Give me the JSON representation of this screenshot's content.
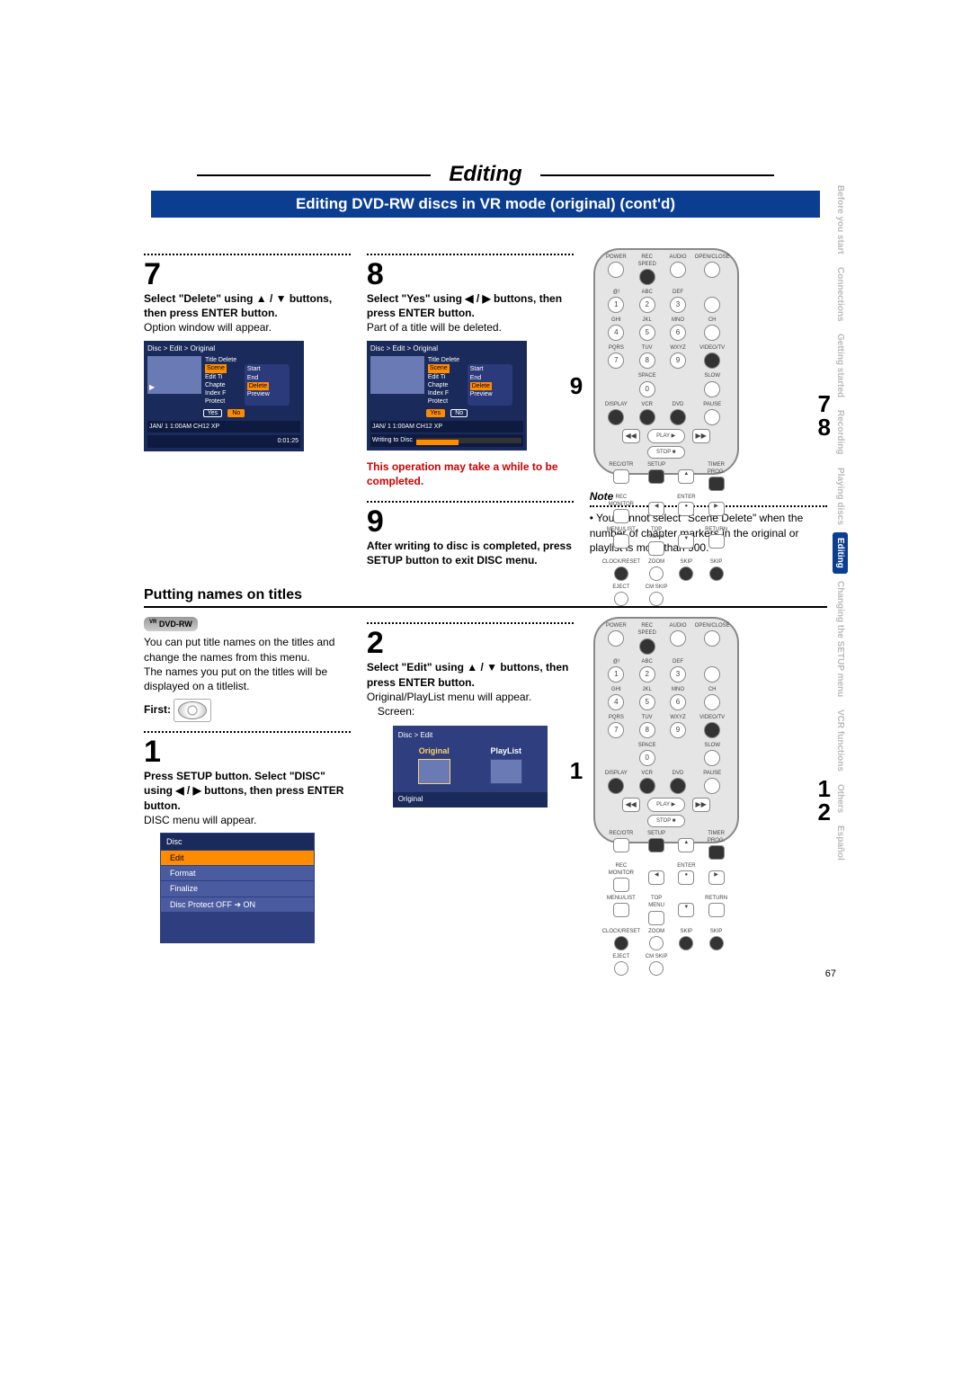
{
  "heading": "Editing",
  "subheading": "Editing DVD-RW discs in VR mode (original) (cont'd)",
  "sidetabs": [
    {
      "label": "Before you start",
      "active": false
    },
    {
      "label": "Connections",
      "active": false
    },
    {
      "label": "Getting started",
      "active": false
    },
    {
      "label": "Recording",
      "active": false
    },
    {
      "label": "Playing discs",
      "active": false
    },
    {
      "label": "Editing",
      "active": true
    },
    {
      "label": "Changing the SETUP menu",
      "active": false
    },
    {
      "label": "VCR functions",
      "active": false
    },
    {
      "label": "Others",
      "active": false
    },
    {
      "label": "Español",
      "active": false
    }
  ],
  "page_number": "67",
  "top": {
    "step7": {
      "num": "7",
      "instr": "Select \"Delete\" using ▲ / ▼ buttons, then press ENTER button.",
      "body": "Option window will appear.",
      "osd": {
        "crumb": "Disc > Edit > Original",
        "menu_top": "Title Delete",
        "menu_items_left": [
          "Scene",
          "Edit Ti",
          "Chapte",
          "Index F",
          "Protect"
        ],
        "menu_items_right": [
          "Start",
          "End",
          "Delete",
          "Preview"
        ],
        "yes": "Yes",
        "no": "No",
        "status_left": "JAN/ 1   1:00AM  CH12    XP",
        "status_right": "0:01:25"
      }
    },
    "step8": {
      "num": "8",
      "instr": "Select \"Yes\" using ◀ / ▶ buttons, then press ENTER button.",
      "body": "Part of a title will be deleted.",
      "osd": {
        "crumb": "Disc > Edit > Original",
        "menu_top": "Title Delete",
        "menu_items_left": [
          "Scene",
          "Edit Ti",
          "Chapte",
          "Index F",
          "Protect"
        ],
        "menu_items_right": [
          "Start",
          "End",
          "Delete",
          "Preview"
        ],
        "yes": "Yes",
        "no": "No",
        "status_left": "JAN/ 1   1:00AM  CH12    XP",
        "writing": "Writing to Disc"
      },
      "warn": "This operation may take a while to be completed."
    },
    "step9": {
      "num": "9",
      "instr": "After writing to disc is completed, press SETUP button to exit DISC menu."
    },
    "note": {
      "title": "Note",
      "body": "• You cannot select \"Scene Delete\" when the number of chapter markers in the original or playlist is more than 900."
    },
    "remote_callouts": {
      "c9": "9",
      "c7": "7",
      "c8": "8"
    }
  },
  "bottom": {
    "section_title": "Putting names on titles",
    "badge": "DVD-RW",
    "badge_vr": "VR",
    "intro1": "You can put title names on the titles and change the names from this menu.",
    "intro2": "The names you put on the titles will be displayed on a titlelist.",
    "first": "First:",
    "step1": {
      "num": "1",
      "instr": "Press SETUP button. Select \"DISC\" using ◀ / ▶ buttons, then press ENTER button.",
      "body": "DISC menu will appear.",
      "menu": {
        "title": "Disc",
        "items": [
          "Edit",
          "Format",
          "Finalize",
          "Disc Protect OFF ➔ ON"
        ],
        "selected": 0
      }
    },
    "step2": {
      "num": "2",
      "instr": "Select \"Edit\" using ▲ / ▼ buttons, then press ENTER button.",
      "body": "Original/PlayList menu will appear.",
      "screen_label": "Screen:",
      "osd": {
        "crumb": "Disc > Edit",
        "tile1": "Original",
        "tile2": "PlayList",
        "foot": "Original"
      }
    },
    "remote_callouts": {
      "left": "1",
      "r1": "1",
      "r2": "2"
    }
  },
  "remote_labels": {
    "row0": [
      "POWER",
      "REC SPEED",
      "AUDIO",
      "OPEN/CLOSE"
    ],
    "row1": [
      "@!",
      "ABC",
      "DEF",
      ""
    ],
    "row1n": [
      "1",
      "2",
      "3",
      ""
    ],
    "row2": [
      "GHI",
      "JKL",
      "MNO",
      "CH"
    ],
    "row2n": [
      "4",
      "5",
      "6",
      ""
    ],
    "row3": [
      "PQRS",
      "TUV",
      "WXYZ",
      "VIDEO/TV"
    ],
    "row3n": [
      "7",
      "8",
      "9",
      ""
    ],
    "row4": [
      "",
      "SPACE",
      "",
      "SLOW"
    ],
    "row4n": [
      "",
      "0",
      "",
      ""
    ],
    "row5": [
      "DISPLAY",
      "VCR",
      "DVD",
      "PAUSE"
    ],
    "nav": {
      "rew": "◀◀",
      "play": "▶",
      "ff": "▶▶",
      "stop": "■",
      "play_label": "PLAY",
      "stop_label": "STOP"
    },
    "row6": [
      "REC/OTR",
      "SETUP",
      "",
      "TIMER PROG."
    ],
    "row7": [
      "REC MONITOR",
      "",
      "ENTER",
      ""
    ],
    "row8": [
      "MENU/LIST",
      "TOP MENU",
      "",
      "RETURN"
    ],
    "row9": [
      "CLOCK/RESET",
      "ZOOM",
      "SKIP",
      "SKIP"
    ],
    "row10": [
      "EJECT",
      "CM SKIP",
      "",
      ""
    ]
  }
}
